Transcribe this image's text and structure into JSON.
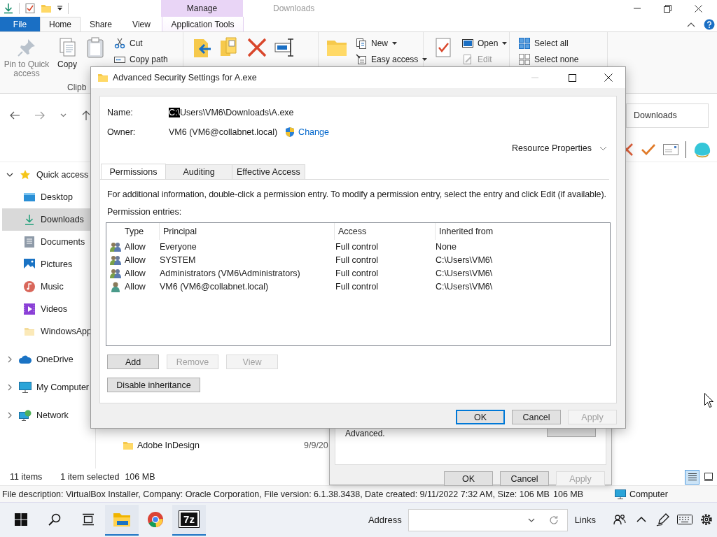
{
  "explorer": {
    "title_bar": {
      "context_tab": "Manage",
      "title": "Downloads"
    },
    "ribbon_tabs": [
      {
        "label": "File",
        "kind": "file",
        "selected": false
      },
      {
        "label": "Home",
        "kind": "tab",
        "selected": true
      },
      {
        "label": "Share",
        "kind": "tab",
        "selected": false
      },
      {
        "label": "View",
        "kind": "tab",
        "selected": false
      },
      {
        "label": "Application Tools",
        "kind": "context",
        "selected": false
      }
    ],
    "ribbon": {
      "pin": {
        "label": "Pin to Quick access",
        "disabled": true
      },
      "copy": {
        "label": "Copy",
        "disabled": false
      },
      "cut": {
        "label": "Cut",
        "disabled": false
      },
      "copy_path": {
        "label": "Copy path",
        "disabled": false
      },
      "clipboard_group": "Clipb",
      "new_item": {
        "label": "New",
        "disabled": false
      },
      "easy_access": {
        "label": "Easy access",
        "disabled": false
      },
      "open": {
        "label": "Open",
        "disabled": false
      },
      "edit": {
        "label": "Edit",
        "disabled": true
      },
      "select_all": {
        "label": "Select all",
        "disabled": false
      },
      "select_none": {
        "label": "Select none",
        "disabled": false
      }
    },
    "search": {
      "placeholder": "Downloads"
    },
    "navigation": [
      {
        "label": "Quick access",
        "kind": "star",
        "expanded": true,
        "selected": false,
        "children": [
          {
            "label": "Desktop",
            "kind": "desktop",
            "selected": false
          },
          {
            "label": "Downloads",
            "kind": "download",
            "selected": true
          },
          {
            "label": "Documents",
            "kind": "document",
            "selected": false
          },
          {
            "label": "Pictures",
            "kind": "picture",
            "selected": false
          },
          {
            "label": "Music",
            "kind": "music",
            "selected": false
          },
          {
            "label": "Videos",
            "kind": "video",
            "selected": false
          },
          {
            "label": "WindowsApp",
            "kind": "folder",
            "selected": false
          }
        ]
      },
      {
        "label": "OneDrive",
        "kind": "cloud",
        "expanded": false,
        "selected": false
      },
      {
        "label": "My Computer",
        "kind": "computer",
        "expanded": false,
        "selected": false
      },
      {
        "label": "Network",
        "kind": "network",
        "expanded": false,
        "selected": false
      }
    ],
    "files": [
      {
        "name": "Adobe InDesign",
        "date": "9/9/20"
      }
    ],
    "status_bar": {
      "count": "11 items",
      "selection": "1 item selected",
      "size": "106 MB"
    },
    "view_buttons": [
      {
        "kind": "details",
        "selected": true
      },
      {
        "kind": "large_icons",
        "selected": false
      }
    ],
    "details_bar": {
      "description": "File description: VirtualBox Installer, Company: Oracle Corporation, File version: 6.1.38.3438, Date created: 9/11/2022 7:32 AM, Size: 106 MB",
      "size": "106 MB",
      "zone": "Computer"
    }
  },
  "properties_dialog": {
    "text": "Advanced.",
    "buttons": [
      {
        "label": "OK",
        "default": false,
        "disabled": false
      },
      {
        "label": "Cancel",
        "default": false,
        "disabled": false
      },
      {
        "label": "Apply",
        "default": false,
        "disabled": true
      }
    ]
  },
  "security_dialog": {
    "title": "Advanced Security Settings for A.exe",
    "name_label": "Name:",
    "name_selection": "C:\\",
    "name_rest": "Users\\VM6\\Downloads\\A.exe",
    "owner_label": "Owner:",
    "owner": "VM6 (VM6@collabnet.local)",
    "change_link": "Change",
    "resource_properties": "Resource Properties",
    "tabs": [
      {
        "label": "Permissions",
        "selected": true
      },
      {
        "label": "Auditing",
        "selected": false
      },
      {
        "label": "Effective Access",
        "selected": false
      }
    ],
    "info": "For additional information, double-click a permission entry. To modify a permission entry, select the entry and click Edit (if available).",
    "entries_label": "Permission entries:",
    "columns": [
      "Type",
      "Principal",
      "Access",
      "Inherited from"
    ],
    "entries": [
      {
        "kind": "group",
        "type": "Allow",
        "principal": "Everyone",
        "access": "Full control",
        "inherited_from": "None"
      },
      {
        "kind": "group",
        "type": "Allow",
        "principal": "SYSTEM",
        "access": "Full control",
        "inherited_from": "C:\\Users\\VM6\\"
      },
      {
        "kind": "group",
        "type": "Allow",
        "principal": "Administrators (VM6\\Administrators)",
        "access": "Full control",
        "inherited_from": "C:\\Users\\VM6\\"
      },
      {
        "kind": "user",
        "type": "Allow",
        "principal": "VM6 (VM6@collabnet.local)",
        "access": "Full control",
        "inherited_from": "C:\\Users\\VM6\\"
      }
    ],
    "entry_buttons": [
      {
        "label": "Add",
        "disabled": false
      },
      {
        "label": "Remove",
        "disabled": true
      },
      {
        "label": "View",
        "disabled": true
      }
    ],
    "inheritance_button": "Disable inheritance",
    "buttons": [
      {
        "label": "OK",
        "default": true,
        "disabled": false
      },
      {
        "label": "Cancel",
        "default": false,
        "disabled": false
      },
      {
        "label": "Apply",
        "default": false,
        "disabled": true
      }
    ]
  },
  "taskbar": {
    "archive_app_label": "7z",
    "address_label": "Address",
    "links_label": "Links"
  }
}
